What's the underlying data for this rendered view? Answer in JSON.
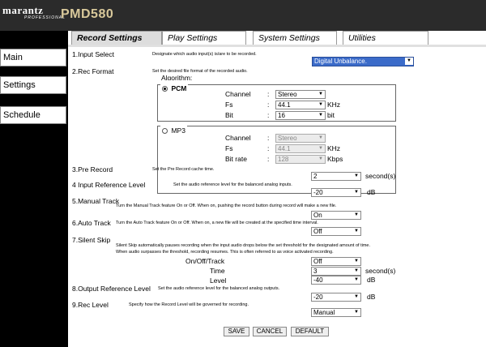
{
  "brand": {
    "name": "marantz",
    "tagline": "PROFESSIONAL",
    "model": "PMD580"
  },
  "sidebar": {
    "items": [
      {
        "label": "Main"
      },
      {
        "label": "Settings"
      },
      {
        "label": "Schedule"
      }
    ]
  },
  "tabs": [
    {
      "label": "Record Settings",
      "active": true
    },
    {
      "label": "Play Settings",
      "active": false
    },
    {
      "label": "System Settings",
      "active": false
    },
    {
      "label": "Utilities",
      "active": false
    }
  ],
  "form": {
    "input_select": {
      "title": "1.Input Select",
      "desc": "Designate which audio input(s) is/are to be recorded.",
      "value": "Digital Unbalance."
    },
    "rec_format": {
      "title": "2.Rec Format",
      "desc": "Set the desired file format of the recorded audio.",
      "algorithm_label": "Algorithm:",
      "pcm": {
        "label": "PCM",
        "selected": true,
        "channel": {
          "label": "Channel",
          "value": "Stereo"
        },
        "fs": {
          "label": "Fs",
          "value": "44.1",
          "unit": "KHz"
        },
        "bit": {
          "label": "Bit",
          "value": "16",
          "unit": "bit"
        }
      },
      "mp3": {
        "label": "MP3",
        "selected": false,
        "channel": {
          "label": "Channel",
          "value": "Stereo"
        },
        "fs": {
          "label": "Fs",
          "value": "44.1",
          "unit": "KHz"
        },
        "bitrate": {
          "label": "Bit rate",
          "value": "128",
          "unit": "Kbps"
        }
      }
    },
    "pre_record": {
      "title": "3.Pre Record",
      "desc": "Set the Pre Record cache time.",
      "value": "2",
      "unit": "second(s)"
    },
    "input_ref": {
      "title": "4 Input Reference Level",
      "desc": "Set the audio reference level for the balanced analog inputs.",
      "value": "-20",
      "unit": "dB"
    },
    "manual_track": {
      "title": "5.Manual Track",
      "desc": "Turn the Manual Track feature On or Off. When on, pushing the record button during record will make a new file.",
      "value": "On"
    },
    "auto_track": {
      "title": "6.Auto Track",
      "desc": "Turn the Auto Track feature On or Off. When on, a new file will be created at the specified time interval.",
      "value": "Off"
    },
    "silent_skip": {
      "title": "7.Silent Skip",
      "desc1": "Silent Skip automatically pauses recording when the input audio drops below the set threshold for the designated amount of time.",
      "desc2": "When audio surpasses the threshold, recording resumes. This is often referred to as voice activated recording.",
      "onoff": {
        "label": "On/Off/Track",
        "value": "Off"
      },
      "time": {
        "label": "Time",
        "value": "3",
        "unit": "second(s)"
      },
      "level": {
        "label": "Level",
        "value": "-40",
        "unit": "dB"
      }
    },
    "output_ref": {
      "title": "8.Output Reference Level",
      "desc": "Set the audio reference level for the balanced analog outputs.",
      "value": "-20",
      "unit": "dB"
    },
    "rec_level": {
      "title": "9.Rec Level",
      "desc": "Specify how the Record Level will be governed for recording.",
      "value": "Manual"
    }
  },
  "buttons": {
    "save": "SAVE",
    "cancel": "CANCEL",
    "default": "DEFAULT"
  },
  "colors": {
    "header": "#2b2b2b",
    "model_text": "#d8c89a",
    "selected_input": "#3b6bc9"
  }
}
